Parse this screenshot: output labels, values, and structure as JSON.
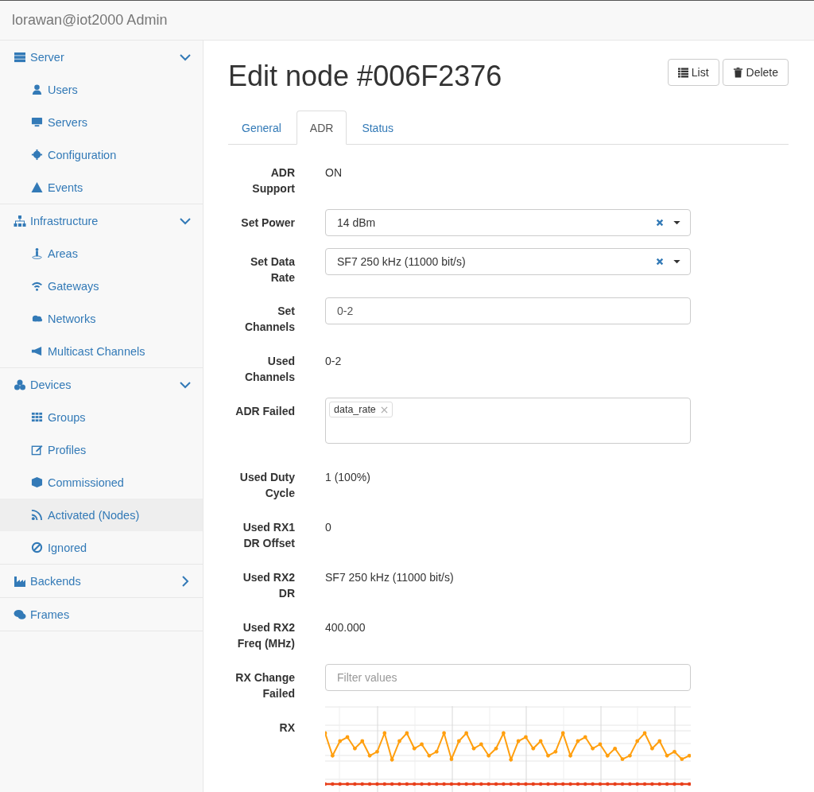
{
  "header": {
    "title": "lorawan@iot2000 Admin"
  },
  "sidebar": {
    "groups": [
      {
        "label": "Server",
        "expanded": true,
        "items": [
          {
            "label": "Users",
            "selected": false
          },
          {
            "label": "Servers",
            "selected": false
          },
          {
            "label": "Configuration",
            "selected": false
          },
          {
            "label": "Events",
            "selected": false
          }
        ]
      },
      {
        "label": "Infrastructure",
        "expanded": true,
        "items": [
          {
            "label": "Areas",
            "selected": false
          },
          {
            "label": "Gateways",
            "selected": false
          },
          {
            "label": "Networks",
            "selected": false
          },
          {
            "label": "Multicast Channels",
            "selected": false
          }
        ]
      },
      {
        "label": "Devices",
        "expanded": true,
        "items": [
          {
            "label": "Groups",
            "selected": false
          },
          {
            "label": "Profiles",
            "selected": false
          },
          {
            "label": "Commissioned",
            "selected": false
          },
          {
            "label": "Activated (Nodes)",
            "selected": true
          },
          {
            "label": "Ignored",
            "selected": false
          }
        ]
      },
      {
        "label": "Backends",
        "expanded": false
      },
      {
        "label": "Frames"
      }
    ]
  },
  "page": {
    "title": "Edit node #006F2376",
    "buttons": [
      {
        "label": "List"
      },
      {
        "label": "Delete"
      }
    ]
  },
  "tabs": [
    {
      "label": "General",
      "selected": false
    },
    {
      "label": "ADR",
      "selected": true
    },
    {
      "label": "Status",
      "selected": false
    }
  ],
  "form": [
    {
      "kind": "text",
      "label": "ADR Support",
      "value": "ON"
    },
    {
      "kind": "select",
      "label": "Set Power",
      "value": "14 dBm"
    },
    {
      "kind": "select",
      "label": "Set Data Rate",
      "value": "SF7 250 kHz (11000 bit/s)"
    },
    {
      "kind": "input",
      "label": "Set Channels",
      "value": "0-2"
    },
    {
      "kind": "text",
      "label": "Used Channels",
      "value": "0-2"
    },
    {
      "kind": "tags",
      "label": "ADR Failed",
      "tags": [
        "data_rate"
      ]
    },
    {
      "kind": "text",
      "label": "Used Duty Cycle",
      "value": "1 (100%)"
    },
    {
      "kind": "text",
      "label": "Used RX1 DR Offset",
      "value": "0"
    },
    {
      "kind": "text",
      "label": "Used RX2 DR",
      "value": "SF7 250 kHz (11000 bit/s)"
    },
    {
      "kind": "text",
      "label": "Used RX2 Freq (MHz)",
      "value": "400.000"
    },
    {
      "kind": "filter",
      "label": "RX Change Failed",
      "placeholder": "Filter values"
    },
    {
      "kind": "chart",
      "label": "RX"
    }
  ]
}
